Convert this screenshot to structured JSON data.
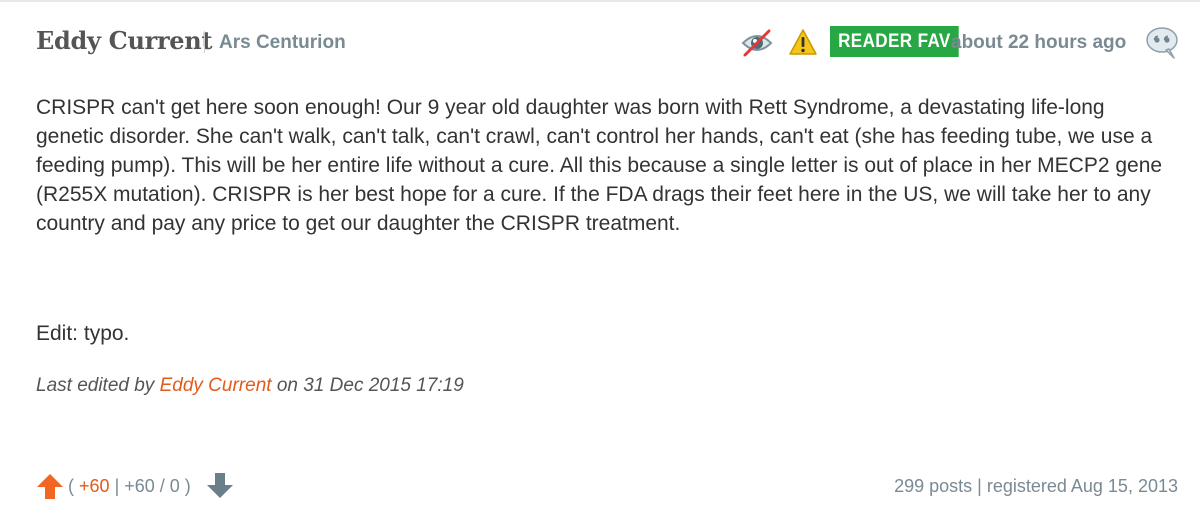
{
  "comment": {
    "author": "Eddy Current",
    "rank": "Ars Centurion",
    "badge": "READER FAV",
    "timestamp": "about 22 hours ago",
    "body": "CRISPR can't get here soon enough! Our 9 year old daughter was born with Rett Syndrome, a devastating life-long genetic disorder. She can't walk, can't talk, can't crawl, can't control her hands, can't eat (she has feeding tube, we use a feeding pump). This will be her entire life without a cure. All this because a single letter is out of place in her MECP2 gene (R255X mutation). CRISPR is her best hope for a cure. If the FDA drags their feet here in the US, we will take her to any country and pay any price to get our daughter the CRISPR treatment.",
    "edit_note": "Edit: typo.",
    "last_edited": {
      "prefix": "Last edited by",
      "editor": "Eddy Current",
      "suffix": "on 31 Dec 2015 17:19"
    },
    "votes": {
      "open": "(",
      "score": "+60",
      "detail": "| +60 / 0 )"
    },
    "user_stats": "299 posts | registered Aug 15, 2013"
  },
  "icons": {
    "hide": "hidden-eye-icon",
    "report": "warning-icon",
    "quote": "quote-bubble-icon",
    "upvote": "upvote-arrow-icon",
    "downvote": "downvote-arrow-icon"
  },
  "colors": {
    "badge_bg": "#28a745",
    "accent_orange": "#e25b1c",
    "muted_gray": "#7a8a93",
    "warning_yellow": "#f5c518"
  }
}
